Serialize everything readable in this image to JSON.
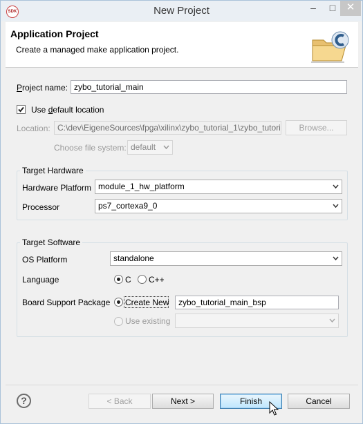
{
  "window": {
    "title": "New Project",
    "app_icon_text": "SDK",
    "minimize": "–",
    "maximize": "□",
    "close": "✕"
  },
  "banner": {
    "title": "Application Project",
    "description": "Create a managed make application project.",
    "icon": "folder-c-icon"
  },
  "project": {
    "name_label": "Project name:",
    "name_value": "zybo_tutorial_main",
    "use_default_label_pre": "Use ",
    "use_default_label_u": "d",
    "use_default_label_post": "efault location",
    "use_default_checked": true,
    "location_label": "Location:",
    "location_value": "C:\\dev\\EigeneSources\\fpga\\xilinx\\zybo_tutorial_1\\zybo_tutori",
    "browse_label": "Browse...",
    "filesystem_label": "Choose file system:",
    "filesystem_value": "default"
  },
  "hardware": {
    "group_title": "Target Hardware",
    "platform_label": "Hardware Platform",
    "platform_value": "module_1_hw_platform",
    "processor_label": "Processor",
    "processor_value": "ps7_cortexa9_0"
  },
  "software": {
    "group_title": "Target Software",
    "os_label": "OS Platform",
    "os_value": "standalone",
    "language_label": "Language",
    "lang_c": "C",
    "lang_cpp": "C++",
    "selected_language": "C",
    "bsp_label": "Board Support Package",
    "create_new_label": "Create New",
    "bsp_name": "zybo_tutorial_main_bsp",
    "use_existing_label": "Use existing",
    "bsp_option": "create_new"
  },
  "buttons": {
    "help": "?",
    "back": "< Back",
    "next": "Next >",
    "finish": "Finish",
    "cancel": "Cancel"
  },
  "colors": {
    "accent": "#3c7fb1",
    "window_bg": "#f0f0f0"
  }
}
